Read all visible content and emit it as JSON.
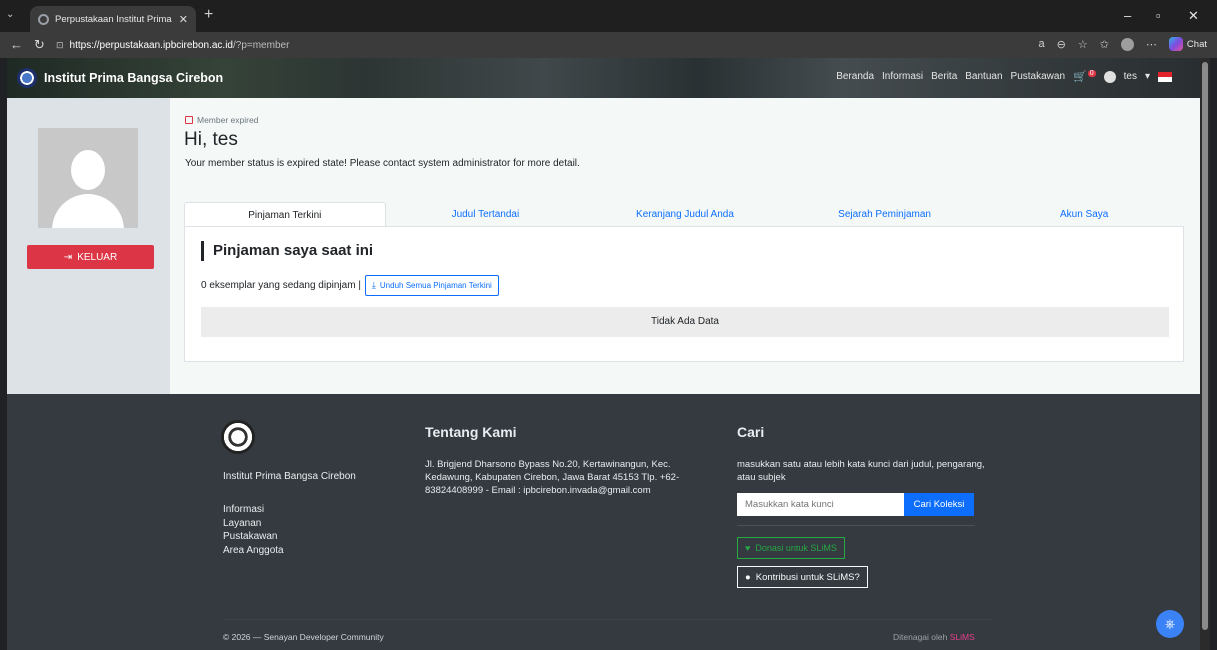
{
  "browser": {
    "tab_title": "Perpustakaan Institut Prima Bangsa",
    "url_host": "https://perpustakaan.ipbcirebon.ac.id",
    "url_path": "/?p=member",
    "chat_label": "Chat"
  },
  "navbar": {
    "brand": "Institut Prima Bangsa Cirebon",
    "menu": [
      "Beranda",
      "Informasi",
      "Berita",
      "Bantuan",
      "Pustakawan"
    ],
    "cart_count": "0",
    "user_name": "tes"
  },
  "sidebar": {
    "logout_label": "KELUAR"
  },
  "member": {
    "status_badge": "Member expired",
    "greeting": "Hi, tes",
    "status_message": "Your member status is expired state! Please contact system administrator for more detail."
  },
  "tabs": [
    {
      "label": "Pinjaman Terkini",
      "active": true
    },
    {
      "label": "Judul Tertandai",
      "active": false
    },
    {
      "label": "Keranjang Judul Anda",
      "active": false
    },
    {
      "label": "Sejarah Peminjaman",
      "active": false
    },
    {
      "label": "Akun Saya",
      "active": false
    }
  ],
  "loans": {
    "title": "Pinjaman saya saat ini",
    "count_text": "0 eksemplar yang sedang dipinjam |",
    "download_label": "Unduh Semua Pinjaman Terkini",
    "empty_text": "Tidak Ada Data"
  },
  "footer": {
    "institution": "Institut Prima Bangsa Cirebon",
    "links": [
      "Informasi",
      "Layanan",
      "Pustakawan",
      "Area Anggota"
    ],
    "about_title": "Tentang Kami",
    "about_text": "Jl. Brigjend Dharsono Bypass No.20, Kertawinangun, Kec. Kedawung, Kabupaten Cirebon, Jawa Barat 45153 Tlp. +62-83824408999 - Email : ipbcirebon.invada@gmail.com",
    "search_title": "Cari",
    "search_desc": "masukkan satu atau lebih kata kunci dari judul, pengarang, atau subjek",
    "search_placeholder": "Masukkan kata kunci",
    "search_button": "Cari Koleksi",
    "donate_label": "Donasi untuk SLiMS",
    "contrib_label": "Kontribusi untuk SLiMS?",
    "copyright": "© 2026 — Senayan Developer Community",
    "powered_prefix": "Ditenagai oleh",
    "powered_brand": "SLiMS"
  },
  "colors": {
    "primary": "#0d6efd",
    "danger": "#dc3545",
    "success": "#28a745",
    "footer_bg": "#343a40"
  }
}
